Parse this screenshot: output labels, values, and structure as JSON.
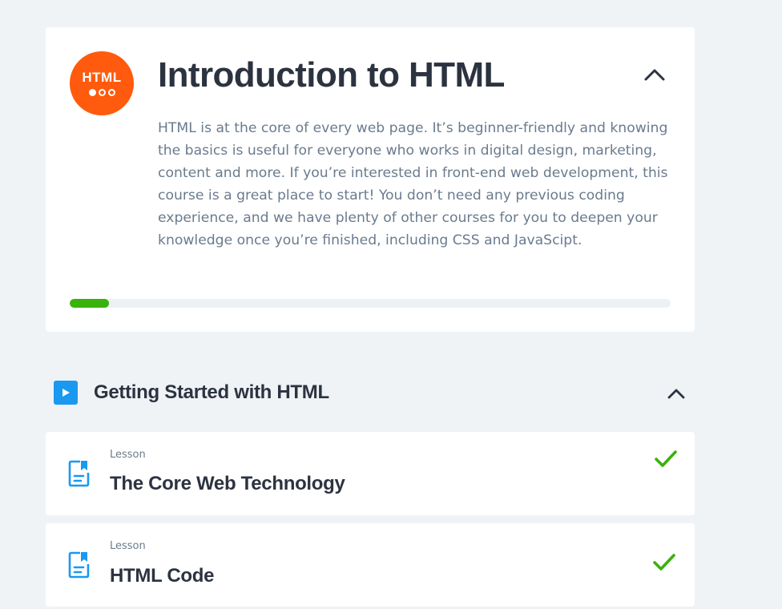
{
  "course": {
    "badge_text": "HTML",
    "title": "Introduction to HTML",
    "description": "HTML is at the core of every web page. It’s beginner-friendly and knowing the basics is useful for everyone who works in digital design, marketing, content and more. If you’re interested in front-end web development, this course is a great place to start! You don’t need any previous coding experience, and we have plenty of other courses for you to deepen your knowledge once you’re finished, including CSS and JavaScipt.",
    "progress_fraction": 0.065,
    "collapse_icon": "chevron-up-icon"
  },
  "section": {
    "icon": "play-icon",
    "title": "Getting Started with HTML",
    "collapse_icon": "chevron-up-icon"
  },
  "lessons": [
    {
      "type": "Lesson",
      "title": "The Core Web Technology",
      "icon": "document-icon",
      "status_icon": "check-icon"
    },
    {
      "type": "Lesson",
      "title": "HTML Code",
      "icon": "document-icon",
      "status_icon": "check-icon"
    }
  ],
  "colors": {
    "background": "#f0f3f6",
    "badge": "#ff5a0d",
    "progress": "#3ab20c",
    "accent_blue": "#1999f0",
    "check_green": "#3ab20c",
    "title_text": "#2c3340",
    "body_text": "#6a7b8e"
  }
}
